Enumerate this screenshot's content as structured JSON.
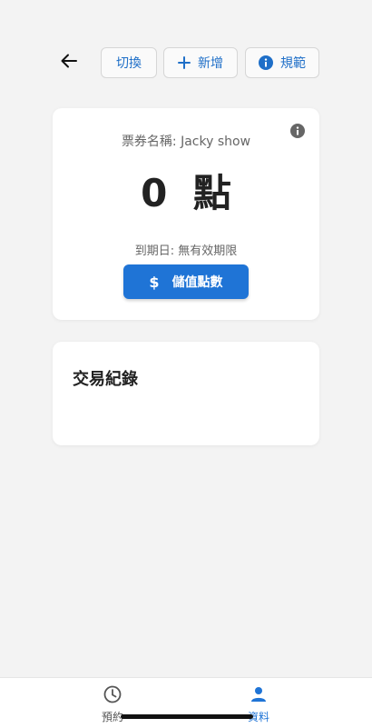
{
  "toolbar": {
    "switch_label": "切換",
    "add_label": "新增",
    "rules_label": "規範"
  },
  "ticket": {
    "name_text": "票券名稱: Jacky show",
    "points_value": "0",
    "points_unit": "點",
    "expiry_text": "到期日: 無有效期限",
    "topup_label": "儲值點數"
  },
  "transactions": {
    "title": "交易紀錄"
  },
  "bottom_nav": {
    "booking_label": "預約",
    "data_label": "資料"
  },
  "icons": {
    "back": "arrow-left-icon",
    "add": "plus-icon",
    "rules": "info-icon",
    "card_info": "info-icon",
    "topup": "dollar-icon",
    "booking": "clock-icon",
    "data": "person-icon"
  },
  "colors": {
    "accent": "#1f74d6",
    "background": "#f3f3f3",
    "card": "#ffffff",
    "info_icon": "#666666"
  }
}
